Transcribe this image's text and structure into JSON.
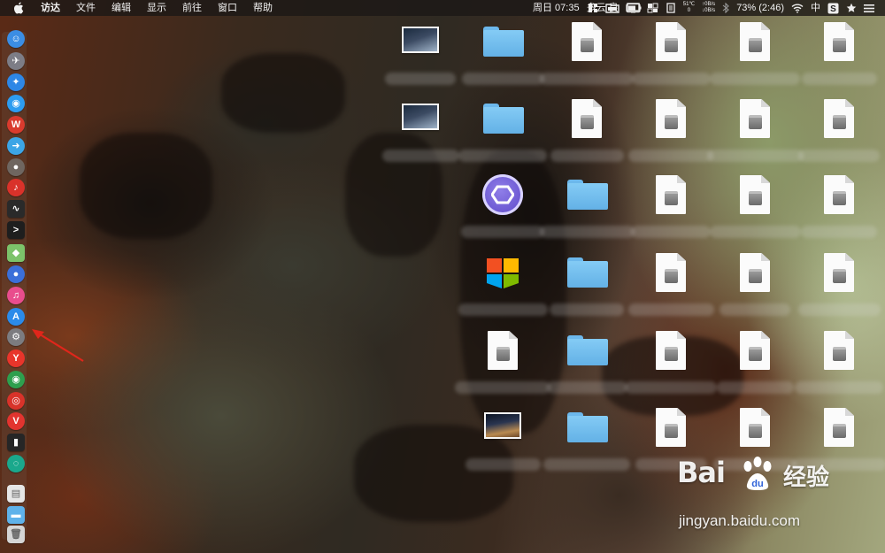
{
  "menubar": {
    "app_name": "访达",
    "menus": [
      "文件",
      "编辑",
      "显示",
      "前往",
      "窗口",
      "帮助"
    ],
    "status": {
      "temperature": "51℃",
      "temperature_sub": "0",
      "net_up": "↑0B/s",
      "net_down": "↓0B/s",
      "clock": "周日 07:35",
      "weather": "多云 良",
      "battery": "73% (2:46)",
      "input_method": "中",
      "status_icons": [
        "grid-icon",
        "folder-icon",
        "monitor-icon",
        "squares-icon",
        "document-icon",
        "cpu-icon",
        "battery-indicator-icon",
        "bluetooth-icon",
        "wifi-icon",
        "s-app-icon",
        "star-icon",
        "menu-list-icon"
      ]
    }
  },
  "dock": {
    "items": [
      {
        "name": "finder",
        "color": "#3b8de4",
        "glyph": "☺"
      },
      {
        "name": "launchpad",
        "color": "#7d7d86",
        "glyph": "✈"
      },
      {
        "name": "safari",
        "color": "#2e87e6",
        "glyph": "✦"
      },
      {
        "name": "preview",
        "color": "#2d9cf0",
        "glyph": "◉"
      },
      {
        "name": "wps",
        "color": "#d93b2e",
        "glyph": "W"
      },
      {
        "name": "migration",
        "color": "#3ca5e6",
        "glyph": "➜"
      },
      {
        "name": "rock",
        "color": "#6f6660",
        "glyph": "●"
      },
      {
        "name": "netease",
        "color": "#d9322a",
        "glyph": "♪"
      },
      {
        "name": "activity",
        "color": "#2a2a2a",
        "glyph": "∿"
      },
      {
        "name": "terminal",
        "color": "#1e1e1e",
        "glyph": ">"
      },
      {
        "name": "maps",
        "color": "#7cc36a",
        "glyph": "◆"
      },
      {
        "name": "siri",
        "color": "#3b6fd9",
        "glyph": "●"
      },
      {
        "name": "itunes",
        "color": "#e94d8d",
        "glyph": "♫"
      },
      {
        "name": "app-store",
        "color": "#2b8bea",
        "glyph": "A"
      },
      {
        "name": "system-prefs",
        "color": "#7c7c80",
        "glyph": "⚙"
      },
      {
        "name": "yandex",
        "color": "#e8352b",
        "glyph": "Y"
      },
      {
        "name": "chrome",
        "color": "#2e9f4e",
        "glyph": "◉"
      },
      {
        "name": "netease-music",
        "color": "#d8332a",
        "glyph": "◎"
      },
      {
        "name": "vivaldi",
        "color": "#e2342f",
        "glyph": "V"
      },
      {
        "name": "terminal-2",
        "color": "#262626",
        "glyph": "▮"
      },
      {
        "name": "cleaner",
        "color": "#1aa88c",
        "glyph": "◌"
      },
      {
        "name": "documents",
        "color": "#e6e6e6",
        "glyph": "▤"
      },
      {
        "name": "downloads-folder",
        "color": "#5fb2ea",
        "glyph": "▬"
      },
      {
        "name": "trash",
        "color": "#d5d5d5",
        "glyph": "🗑"
      }
    ]
  },
  "desktop": {
    "rows": [
      [
        "screenshot",
        "folder",
        "doc",
        "doc",
        "doc",
        "doc"
      ],
      [
        "screenshot",
        "folder",
        "doc",
        "doc",
        "doc",
        "doc"
      ],
      [
        "round-app",
        "folder",
        "doc",
        "doc",
        "doc"
      ],
      [
        "windows-app",
        "folder",
        "doc",
        "doc",
        "doc"
      ],
      [
        "doc",
        "folder",
        "doc",
        "doc",
        "doc"
      ],
      [
        "photo",
        "folder",
        "doc",
        "doc",
        "doc"
      ]
    ],
    "icon_folder_color": "#6cb8ec"
  },
  "annotation": {
    "arrow_color": "#e0261b"
  },
  "watermark": {
    "brand_latin": "Bai",
    "brand_cn": "经验",
    "url": "jingyan.baidu.com"
  }
}
